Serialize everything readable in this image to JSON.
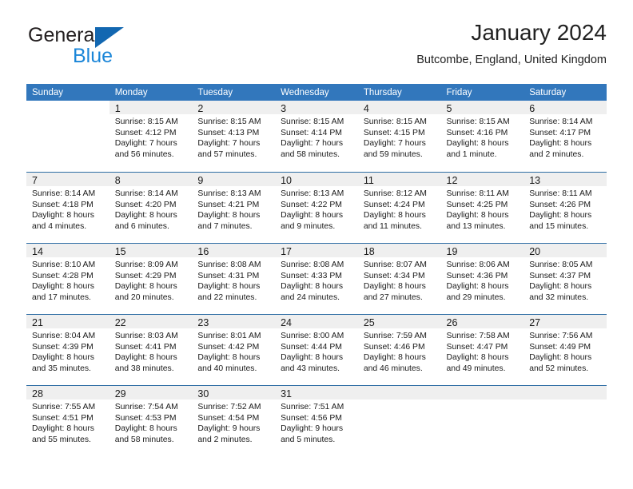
{
  "brand": {
    "name_top": "General",
    "name_bottom": "Blue",
    "triangle_color": "#1267b1",
    "blue_color": "#1b86d8"
  },
  "header": {
    "title": "January 2024",
    "subtitle": "Butcombe, England, United Kingdom"
  },
  "colors": {
    "header_row_bg": "#3277bc",
    "header_row_text": "#ffffff",
    "daynum_band_bg": "#efefef",
    "cell_separator": "#2e6da4",
    "body_text": "#1a1a1a"
  },
  "weekday_headers": [
    "Sunday",
    "Monday",
    "Tuesday",
    "Wednesday",
    "Thursday",
    "Friday",
    "Saturday"
  ],
  "labels": {
    "sunrise_prefix": "Sunrise:",
    "sunset_prefix": "Sunset:",
    "daylight_prefix": "Daylight:"
  },
  "weeks": [
    [
      {
        "empty": true
      },
      {
        "day": "1",
        "sunrise": "Sunrise: 8:15 AM",
        "sunset": "Sunset: 4:12 PM",
        "daylight_1": "Daylight: 7 hours",
        "daylight_2": "and 56 minutes."
      },
      {
        "day": "2",
        "sunrise": "Sunrise: 8:15 AM",
        "sunset": "Sunset: 4:13 PM",
        "daylight_1": "Daylight: 7 hours",
        "daylight_2": "and 57 minutes."
      },
      {
        "day": "3",
        "sunrise": "Sunrise: 8:15 AM",
        "sunset": "Sunset: 4:14 PM",
        "daylight_1": "Daylight: 7 hours",
        "daylight_2": "and 58 minutes."
      },
      {
        "day": "4",
        "sunrise": "Sunrise: 8:15 AM",
        "sunset": "Sunset: 4:15 PM",
        "daylight_1": "Daylight: 7 hours",
        "daylight_2": "and 59 minutes."
      },
      {
        "day": "5",
        "sunrise": "Sunrise: 8:15 AM",
        "sunset": "Sunset: 4:16 PM",
        "daylight_1": "Daylight: 8 hours",
        "daylight_2": "and 1 minute."
      },
      {
        "day": "6",
        "sunrise": "Sunrise: 8:14 AM",
        "sunset": "Sunset: 4:17 PM",
        "daylight_1": "Daylight: 8 hours",
        "daylight_2": "and 2 minutes."
      }
    ],
    [
      {
        "day": "7",
        "sunrise": "Sunrise: 8:14 AM",
        "sunset": "Sunset: 4:18 PM",
        "daylight_1": "Daylight: 8 hours",
        "daylight_2": "and 4 minutes."
      },
      {
        "day": "8",
        "sunrise": "Sunrise: 8:14 AM",
        "sunset": "Sunset: 4:20 PM",
        "daylight_1": "Daylight: 8 hours",
        "daylight_2": "and 6 minutes."
      },
      {
        "day": "9",
        "sunrise": "Sunrise: 8:13 AM",
        "sunset": "Sunset: 4:21 PM",
        "daylight_1": "Daylight: 8 hours",
        "daylight_2": "and 7 minutes."
      },
      {
        "day": "10",
        "sunrise": "Sunrise: 8:13 AM",
        "sunset": "Sunset: 4:22 PM",
        "daylight_1": "Daylight: 8 hours",
        "daylight_2": "and 9 minutes."
      },
      {
        "day": "11",
        "sunrise": "Sunrise: 8:12 AM",
        "sunset": "Sunset: 4:24 PM",
        "daylight_1": "Daylight: 8 hours",
        "daylight_2": "and 11 minutes."
      },
      {
        "day": "12",
        "sunrise": "Sunrise: 8:11 AM",
        "sunset": "Sunset: 4:25 PM",
        "daylight_1": "Daylight: 8 hours",
        "daylight_2": "and 13 minutes."
      },
      {
        "day": "13",
        "sunrise": "Sunrise: 8:11 AM",
        "sunset": "Sunset: 4:26 PM",
        "daylight_1": "Daylight: 8 hours",
        "daylight_2": "and 15 minutes."
      }
    ],
    [
      {
        "day": "14",
        "sunrise": "Sunrise: 8:10 AM",
        "sunset": "Sunset: 4:28 PM",
        "daylight_1": "Daylight: 8 hours",
        "daylight_2": "and 17 minutes."
      },
      {
        "day": "15",
        "sunrise": "Sunrise: 8:09 AM",
        "sunset": "Sunset: 4:29 PM",
        "daylight_1": "Daylight: 8 hours",
        "daylight_2": "and 20 minutes."
      },
      {
        "day": "16",
        "sunrise": "Sunrise: 8:08 AM",
        "sunset": "Sunset: 4:31 PM",
        "daylight_1": "Daylight: 8 hours",
        "daylight_2": "and 22 minutes."
      },
      {
        "day": "17",
        "sunrise": "Sunrise: 8:08 AM",
        "sunset": "Sunset: 4:33 PM",
        "daylight_1": "Daylight: 8 hours",
        "daylight_2": "and 24 minutes."
      },
      {
        "day": "18",
        "sunrise": "Sunrise: 8:07 AM",
        "sunset": "Sunset: 4:34 PM",
        "daylight_1": "Daylight: 8 hours",
        "daylight_2": "and 27 minutes."
      },
      {
        "day": "19",
        "sunrise": "Sunrise: 8:06 AM",
        "sunset": "Sunset: 4:36 PM",
        "daylight_1": "Daylight: 8 hours",
        "daylight_2": "and 29 minutes."
      },
      {
        "day": "20",
        "sunrise": "Sunrise: 8:05 AM",
        "sunset": "Sunset: 4:37 PM",
        "daylight_1": "Daylight: 8 hours",
        "daylight_2": "and 32 minutes."
      }
    ],
    [
      {
        "day": "21",
        "sunrise": "Sunrise: 8:04 AM",
        "sunset": "Sunset: 4:39 PM",
        "daylight_1": "Daylight: 8 hours",
        "daylight_2": "and 35 minutes."
      },
      {
        "day": "22",
        "sunrise": "Sunrise: 8:03 AM",
        "sunset": "Sunset: 4:41 PM",
        "daylight_1": "Daylight: 8 hours",
        "daylight_2": "and 38 minutes."
      },
      {
        "day": "23",
        "sunrise": "Sunrise: 8:01 AM",
        "sunset": "Sunset: 4:42 PM",
        "daylight_1": "Daylight: 8 hours",
        "daylight_2": "and 40 minutes."
      },
      {
        "day": "24",
        "sunrise": "Sunrise: 8:00 AM",
        "sunset": "Sunset: 4:44 PM",
        "daylight_1": "Daylight: 8 hours",
        "daylight_2": "and 43 minutes."
      },
      {
        "day": "25",
        "sunrise": "Sunrise: 7:59 AM",
        "sunset": "Sunset: 4:46 PM",
        "daylight_1": "Daylight: 8 hours",
        "daylight_2": "and 46 minutes."
      },
      {
        "day": "26",
        "sunrise": "Sunrise: 7:58 AM",
        "sunset": "Sunset: 4:47 PM",
        "daylight_1": "Daylight: 8 hours",
        "daylight_2": "and 49 minutes."
      },
      {
        "day": "27",
        "sunrise": "Sunrise: 7:56 AM",
        "sunset": "Sunset: 4:49 PM",
        "daylight_1": "Daylight: 8 hours",
        "daylight_2": "and 52 minutes."
      }
    ],
    [
      {
        "day": "28",
        "sunrise": "Sunrise: 7:55 AM",
        "sunset": "Sunset: 4:51 PM",
        "daylight_1": "Daylight: 8 hours",
        "daylight_2": "and 55 minutes."
      },
      {
        "day": "29",
        "sunrise": "Sunrise: 7:54 AM",
        "sunset": "Sunset: 4:53 PM",
        "daylight_1": "Daylight: 8 hours",
        "daylight_2": "and 58 minutes."
      },
      {
        "day": "30",
        "sunrise": "Sunrise: 7:52 AM",
        "sunset": "Sunset: 4:54 PM",
        "daylight_1": "Daylight: 9 hours",
        "daylight_2": "and 2 minutes."
      },
      {
        "day": "31",
        "sunrise": "Sunrise: 7:51 AM",
        "sunset": "Sunset: 4:56 PM",
        "daylight_1": "Daylight: 9 hours",
        "daylight_2": "and 5 minutes."
      },
      {
        "empty": true,
        "trailing": true
      },
      {
        "empty": true,
        "trailing": true
      },
      {
        "empty": true,
        "trailing": true
      }
    ]
  ]
}
